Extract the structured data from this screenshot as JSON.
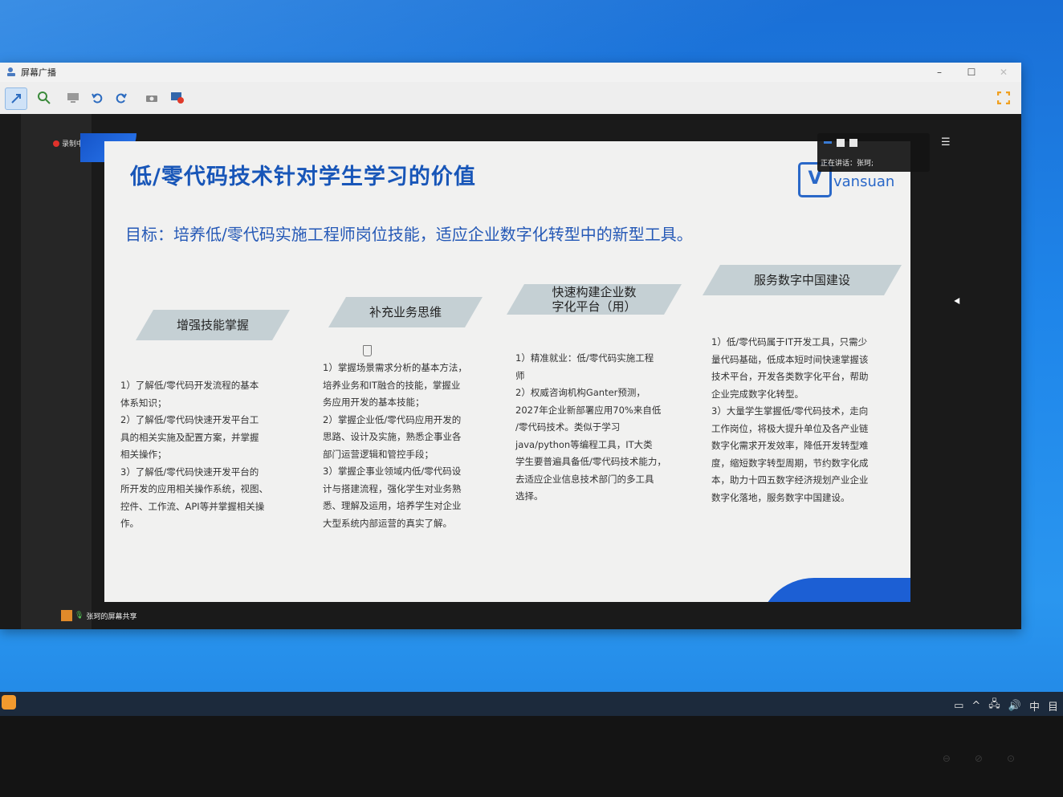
{
  "window": {
    "title": "屏幕广播",
    "controls": {
      "minimize": "–",
      "maximize": "☐",
      "close": "✕"
    }
  },
  "toolbar": {
    "icons": [
      "pointer-icon",
      "zoom-icon",
      "screen-icon",
      "undo-icon",
      "redo-icon",
      "camera-icon",
      "record-icon"
    ]
  },
  "recording": {
    "label": "录制中"
  },
  "float_panel": {
    "speaking": "正在讲话：张珂;"
  },
  "slide": {
    "heading": "低/零代码技术针对学生学习的价值",
    "goal": "目标：培养低/零代码实施工程师岗位技能，适应企业数字化转型中的新型工具。",
    "logo_letter": "V",
    "logo_text": "vansuan",
    "banners": [
      "增强技能掌握",
      "补充业务思维",
      "快速构建企业数\n字化平台（用）",
      "服务数字中国建设"
    ],
    "columns": [
      "1）了解低/零代码开发流程的基本\n体系知识；\n2）了解低/零代码快速开发平台工\n具的相关实施及配置方案，并掌握\n相关操作；\n3）了解低/零代码快速开发平台的\n所开发的应用相关操作系统，视图、\n控件、工作流、API等并掌握相关操\n作。",
      "1）掌握场景需求分析的基本方法，\n培养业务和IT融合的技能，掌握业\n务应用开发的基本技能；\n2）掌握企业低/零代码应用开发的\n思路、设计及实施，熟悉企事业各\n部门运营逻辑和管控手段；\n3）掌握企事业领域内低/零代码设\n计与搭建流程，强化学生对业务熟\n悉、理解及运用，培养学生对企业\n大型系统内部运营的真实了解。",
      "1）精准就业：低/零代码实施工程\n师\n2）权威咨询机构Ganter预测，\n2027年企业新部署应用70%来自低\n/零代码技术。类似于学习\njava/python等编程工具，IT大类\n学生要普遍具备低/零代码技术能力，\n去适应企业信息技术部门的多工具\n选择。",
      "1）低/零代码属于IT开发工具，只需少\n量代码基础，低成本短时间快速掌握该\n技术平台，开发各类数字化平台，帮助\n企业完成数字化转型。\n3）大量学生掌握低/零代码技术，走向\n工作岗位，将极大提升单位及各产业链\n数字化需求开发效率，降低开发转型难\n度，缩短数字转型周期，节约数字化成\n本，助力十四五数字经济规划产业企业\n数字化落地，服务数字中国建设。"
    ]
  },
  "share_status": {
    "label": "张珂的屏幕共享"
  },
  "taskbar": {
    "tray": [
      "▭",
      "^",
      "🖧",
      "🔊",
      "中",
      "目"
    ]
  }
}
